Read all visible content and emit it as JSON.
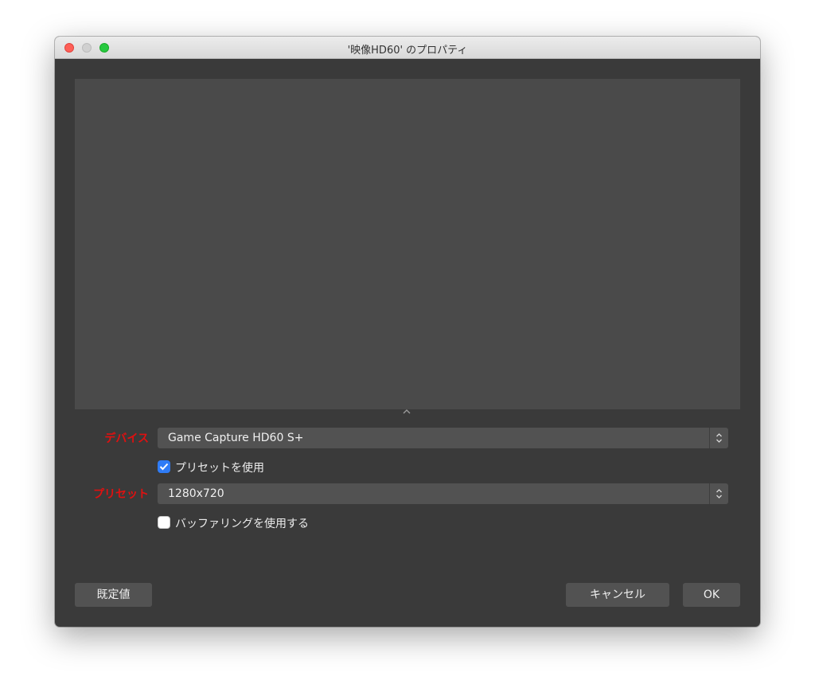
{
  "window": {
    "title": "'映像HD60' のプロパティ"
  },
  "form": {
    "device": {
      "label": "デバイス",
      "value": "Game Capture HD60 S+"
    },
    "use_preset": {
      "label": "プリセットを使用",
      "checked": true
    },
    "preset": {
      "label": "プリセット",
      "value": "1280x720"
    },
    "use_buffering": {
      "label": "バッファリングを使用する",
      "checked": false
    }
  },
  "buttons": {
    "defaults": "既定値",
    "cancel": "キャンセル",
    "ok": "OK"
  },
  "colors": {
    "label_highlight": "#e01010",
    "checkbox_accent": "#2f7cf6"
  },
  "icons": {
    "splitter": "chevron-up-icon",
    "select_stepper": "up-down-chevron-icon",
    "checkmark": "checkmark-icon"
  }
}
